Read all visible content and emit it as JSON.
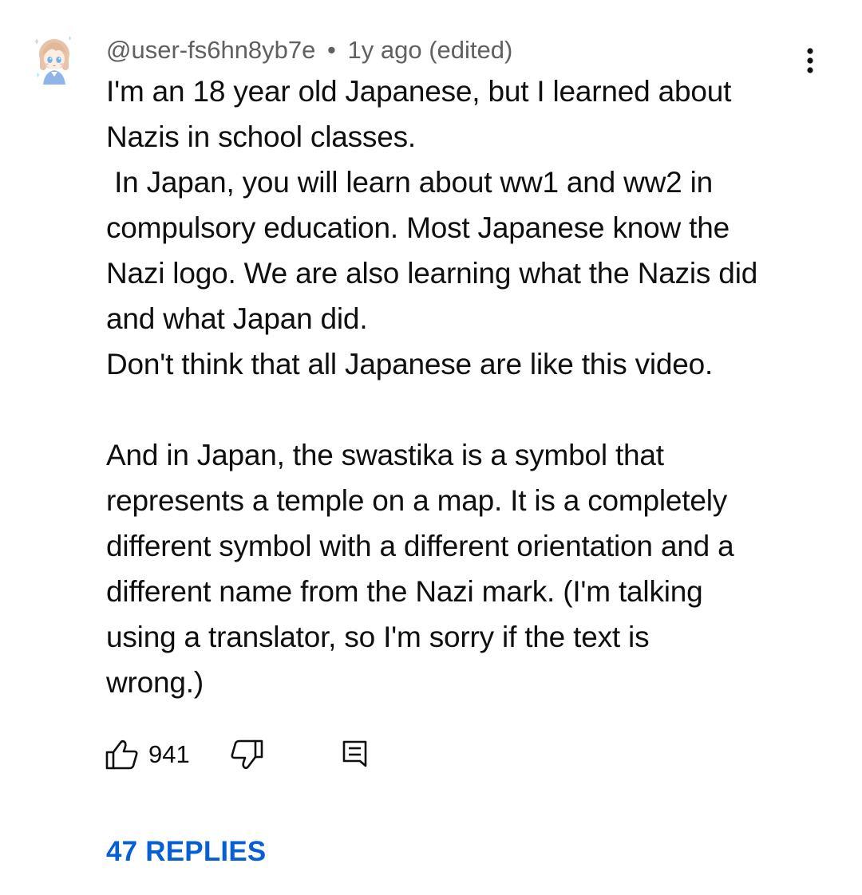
{
  "comment": {
    "author": "@user-fs6hn8yb7e",
    "separator": "•",
    "time": "1y ago",
    "edited": "(edited)",
    "text": "I'm an 18 year old Japanese, but I learned about\nNazis in school classes.\n In Japan, you will learn about ww1 and ww2 in\ncompulsory education. Most Japanese know the\nNazi logo. We are also learning what the Nazis did\nand what Japan did.\nDon't think that all Japanese are like this video.\n\nAnd in Japan, the swastika is a symbol that\nrepresents a temple on a map. It is a completely\ndifferent symbol with a different orientation and a\ndifferent name from the Nazi mark. (I'm talking\nusing a translator, so I'm sorry if the text is\nwrong.)",
    "likes": "941",
    "replies": "47 REPLIES"
  },
  "icons": {
    "avatar": "anime-avatar",
    "menu": "more-vertical-icon",
    "like": "thumb-up-icon",
    "dislike": "thumb-down-icon",
    "reply": "reply-comment-icon"
  },
  "colors": {
    "text": "#0f0f0f",
    "meta": "#606060",
    "link": "#065fd4"
  }
}
